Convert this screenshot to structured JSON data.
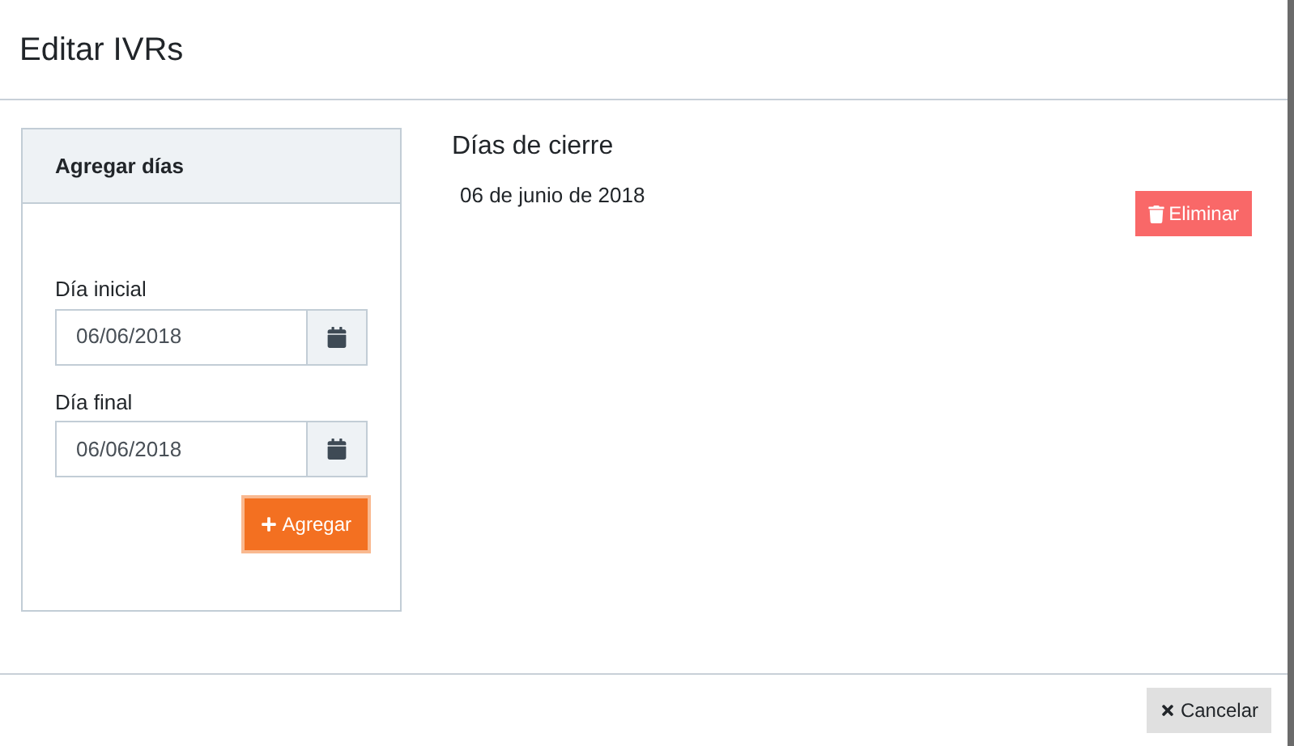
{
  "title": "Editar IVRs",
  "add_panel": {
    "title": "Agregar días",
    "fields": [
      {
        "label": "Día inicial",
        "value": "06/06/2018"
      },
      {
        "label": "Día final",
        "value": "06/06/2018"
      }
    ],
    "add_button": "Agregar"
  },
  "closing_days": {
    "title": "Días de cierre",
    "items": [
      {
        "date": "06 de junio de 2018",
        "delete_button": "Eliminar"
      }
    ]
  },
  "footer": {
    "cancel_button": "Cancelar"
  }
}
